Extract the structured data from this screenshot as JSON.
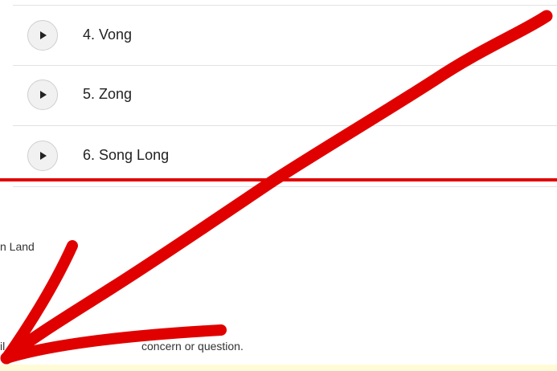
{
  "tracks": [
    {
      "title": "4. Vong"
    },
    {
      "title": "5. Zong"
    },
    {
      "title": "6. Song Long"
    }
  ],
  "fragments": {
    "land": "n Land",
    "il": "il",
    "concern": "concern or question."
  },
  "annotation": {
    "color": "#e10000",
    "icon": "red-arrow-annotation"
  },
  "colors": {
    "highlight_bar": "#fffbd6",
    "divider": "#e10000"
  }
}
